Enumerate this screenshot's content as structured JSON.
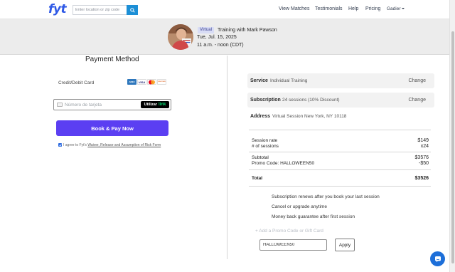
{
  "header": {
    "logo": "fyt",
    "search_placeholder": "Enter location or zip code",
    "nav": [
      "View Matches",
      "Testimonials",
      "Help",
      "Pricing"
    ],
    "account_label": "Gadier"
  },
  "session": {
    "badge": "Virtual",
    "title": "Training with Mark Pawson",
    "date": "Tue, Jul. 15, 2025",
    "time": "11 a.m. - noon (CDT)"
  },
  "payment": {
    "heading": "Payment Method",
    "card_label": "Credit/Debit Card",
    "card_brands": [
      "AMEX",
      "VISA",
      "MC",
      "DISCOVER"
    ],
    "card_placeholder": "Número de tarjeta",
    "link_button_label": "Utilizar",
    "link_button_brand": "link",
    "book_button": "Book & Pay Now",
    "agree_prefix": "I agree to Fyt's",
    "agree_link": "Waiver, Release and Assumption of Risk Form",
    "agree_checked": true
  },
  "summary": {
    "service_label": "Service",
    "service_value": "Individual Training",
    "subscription_label": "Subscription",
    "subscription_value": "24 sessions (10% Discount)",
    "address_label": "Address",
    "address_value": "Virtual Session New York, NY 10118",
    "change_label": "Change",
    "session_rate_label": "Session rate",
    "session_rate_value": "$149",
    "sessions_label": "# of sessions",
    "sessions_value": "x24",
    "subtotal_label": "Subtotal",
    "subtotal_value": "$3576",
    "promo_label": "Promo Code: HALLOWEEN50",
    "promo_value": "-$50",
    "total_label": "Total",
    "total_value": "$3526",
    "notes": [
      "Subscription renews after you book your last session",
      "Cancel or upgrade anytime",
      "Money back guarantee after first session"
    ],
    "promo_link": "+ Add a Promo Code or Gift Card",
    "promo_code_value": "HALLOWEEN50",
    "apply_label": "Apply"
  },
  "colors": {
    "brand_blue": "#2f59e6",
    "book_button": "#5b3ff2",
    "search_button": "#1c8fd6",
    "chat_button": "#1d6fd9"
  },
  "icons": [
    "search-icon",
    "caret-down-icon",
    "card-icon",
    "chat-icon"
  ]
}
